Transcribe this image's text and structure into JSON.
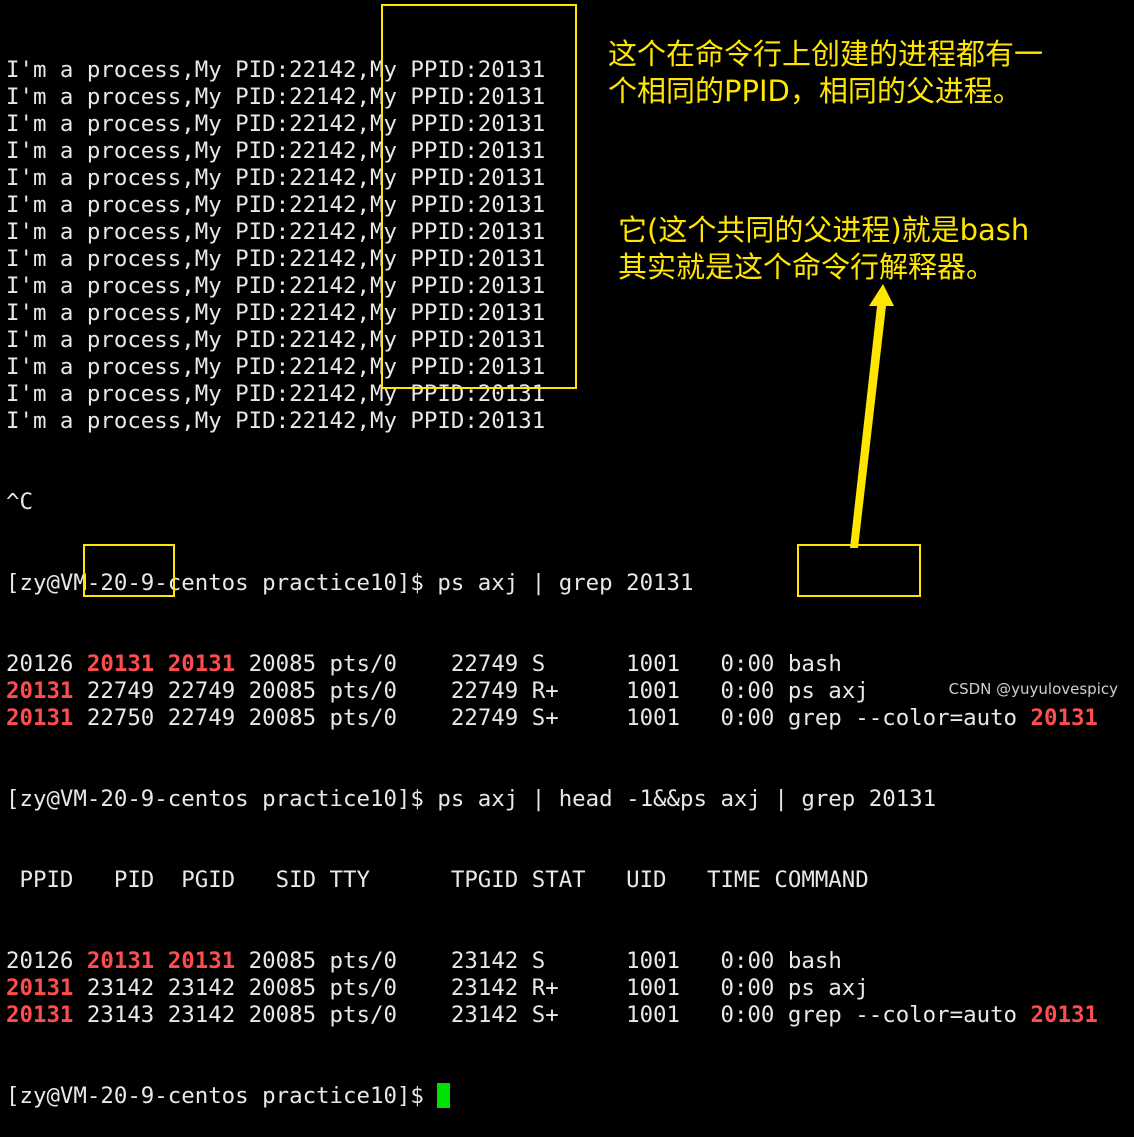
{
  "terminal": {
    "loop_text": "I'm a process,My PID:22142,My PPID:20131",
    "loop_count": 14,
    "interrupt": "^C",
    "prompt1": "[zy@VM-20-9-centos practice10]$ ps axj | grep 20131",
    "grep1_rows": [
      [
        {
          "t": "20126 "
        },
        {
          "t": "20131",
          "h": true
        },
        {
          "t": " "
        },
        {
          "t": "20131",
          "h": true
        },
        {
          "t": " 20085 pts/0    22749 S      1001   0:00 bash"
        }
      ],
      [
        {
          "t": "20131",
          "h": true
        },
        {
          "t": " 22749 22749 20085 pts/0    22749 R+     1001   0:00 ps axj"
        }
      ],
      [
        {
          "t": "20131",
          "h": true
        },
        {
          "t": " 22750 22749 20085 pts/0    22749 S+     1001   0:00 grep --color=auto "
        },
        {
          "t": "20131",
          "h": true
        }
      ]
    ],
    "prompt2": "[zy@VM-20-9-centos practice10]$ ps axj | head -1&&ps axj | grep 20131",
    "header_row": " PPID   PID  PGID   SID TTY      TPGID STAT   UID   TIME COMMAND",
    "grep2_rows": [
      [
        {
          "t": "20126 "
        },
        {
          "t": "20131",
          "h": true
        },
        {
          "t": " "
        },
        {
          "t": "20131",
          "h": true
        },
        {
          "t": " 20085 pts/0    23142 S      1001   0:00 bash"
        }
      ],
      [
        {
          "t": "20131",
          "h": true
        },
        {
          "t": " 23142 23142 20085 pts/0    23142 R+     1001   0:00 ps axj"
        }
      ],
      [
        {
          "t": "20131",
          "h": true
        },
        {
          "t": " 23143 23142 20085 pts/0    23142 S+     1001   0:00 grep --color=auto "
        },
        {
          "t": "20131",
          "h": true
        }
      ]
    ],
    "final_prompt": "[zy@VM-20-9-centos practice10]$ "
  },
  "annotations": {
    "note1": "这个在命令行上创建的进程都有一\n个相同的PPID，相同的父进程。",
    "note2": "它(这个共同的父进程)就是bash\n其实就是这个命令行解释器。"
  },
  "colors": {
    "highlight": "#ff4d4d",
    "annotation": "#ffe600",
    "cursor": "#00e000"
  },
  "watermark": "CSDN @yuyulovespicy"
}
